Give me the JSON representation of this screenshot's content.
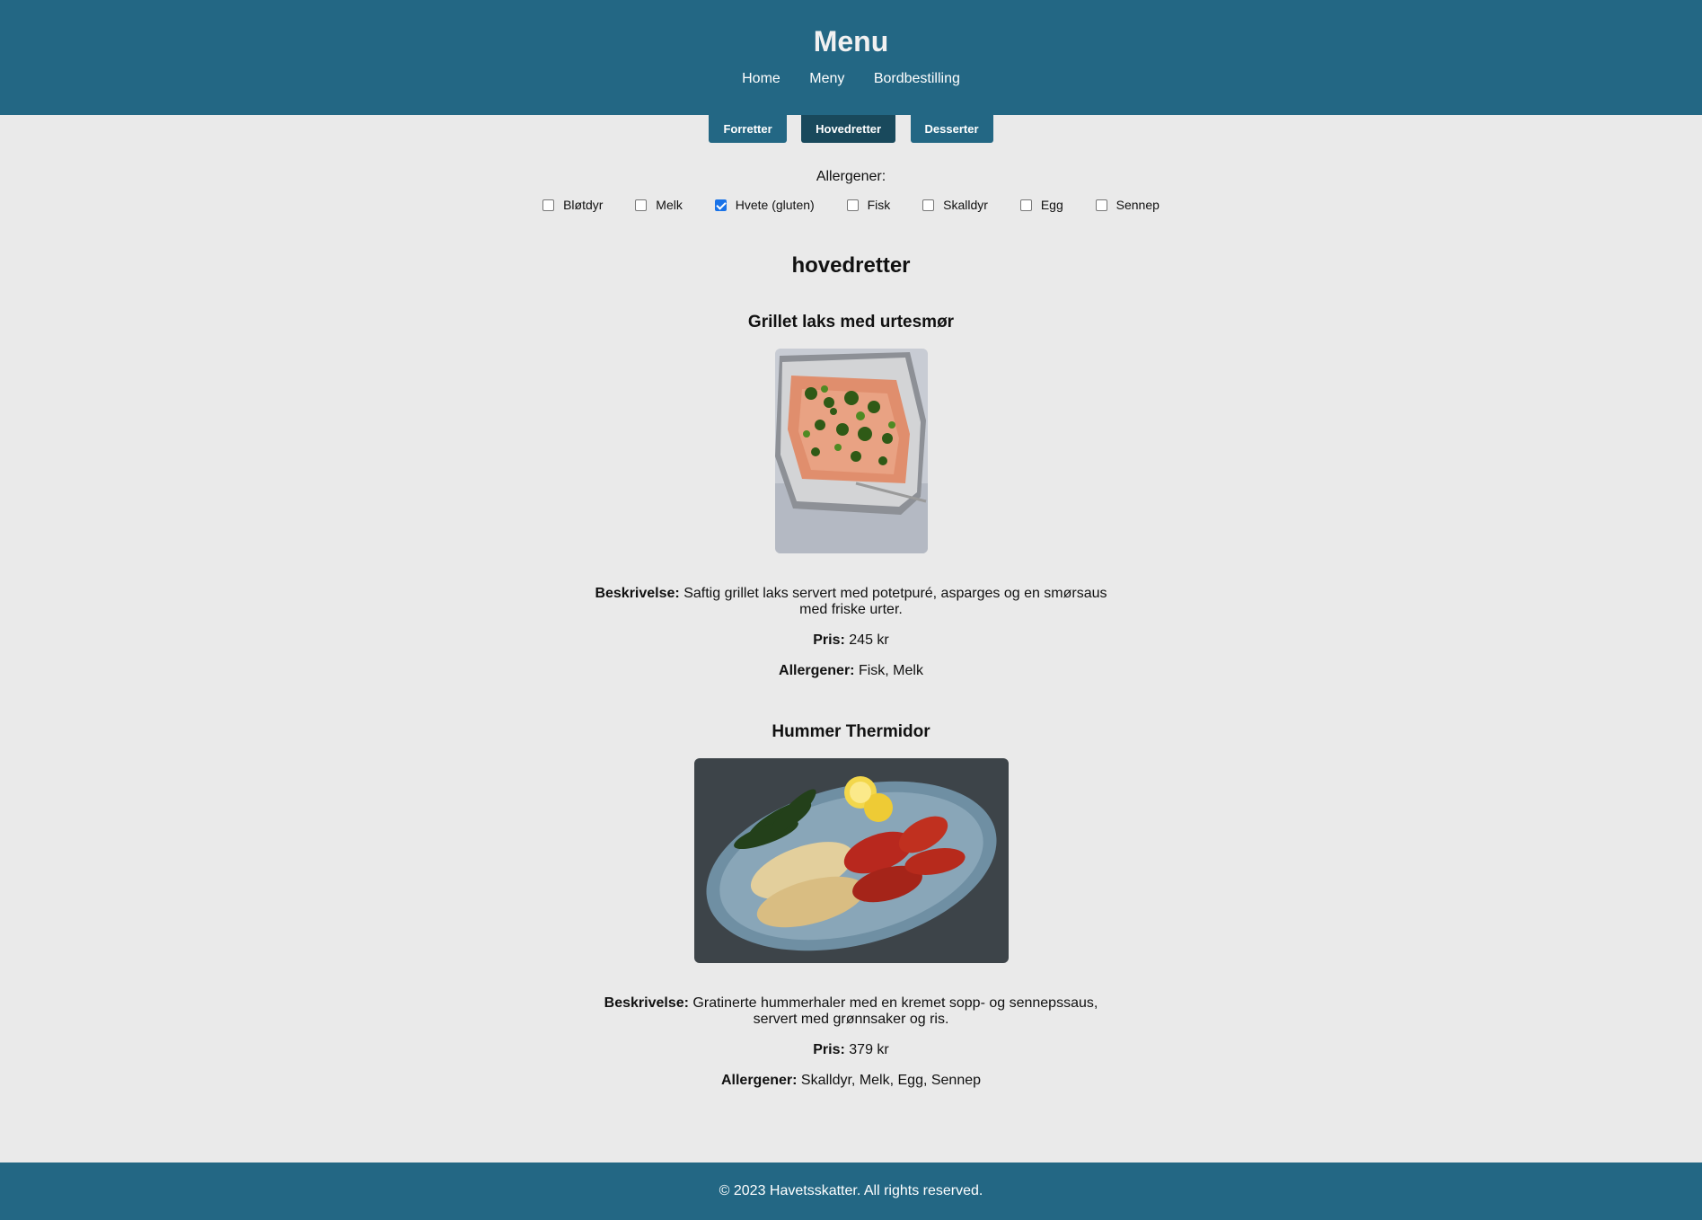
{
  "header": {
    "title": "Menu",
    "nav": [
      "Home",
      "Meny",
      "Bordbestilling"
    ]
  },
  "tabs": [
    {
      "label": "Forretter",
      "active": false
    },
    {
      "label": "Hovedretter",
      "active": true
    },
    {
      "label": "Desserter",
      "active": false
    }
  ],
  "filters": {
    "title": "Allergener:",
    "options": [
      {
        "label": "Bløtdyr",
        "checked": false
      },
      {
        "label": "Melk",
        "checked": false
      },
      {
        "label": "Hvete (gluten)",
        "checked": true
      },
      {
        "label": "Fisk",
        "checked": false
      },
      {
        "label": "Skalldyr",
        "checked": false
      },
      {
        "label": "Egg",
        "checked": false
      },
      {
        "label": "Sennep",
        "checked": false
      }
    ]
  },
  "section": {
    "title": "hovedretter"
  },
  "dishes": [
    {
      "name": "Grillet laks med urtesmør",
      "desc_label": "Beskrivelse:",
      "desc": "Saftig grillet laks servert med potetpuré, asparges og en smørsaus med friske urter.",
      "price_label": "Pris:",
      "price": "245 kr",
      "allergens_label": "Allergener:",
      "allergens": "Fisk, Melk"
    },
    {
      "name": "Hummer Thermidor",
      "desc_label": "Beskrivelse:",
      "desc": "Gratinerte hummerhaler med en kremet sopp- og sennepssaus, servert med grønnsaker og ris.",
      "price_label": "Pris:",
      "price": "379 kr",
      "allergens_label": "Allergener:",
      "allergens": "Skalldyr, Melk, Egg, Sennep"
    }
  ],
  "footer": {
    "text": "© 2023 Havetsskatter. All rights reserved."
  },
  "colors": {
    "brand": "#236784",
    "active_tab": "#19495c",
    "background": "#eaeaea"
  }
}
